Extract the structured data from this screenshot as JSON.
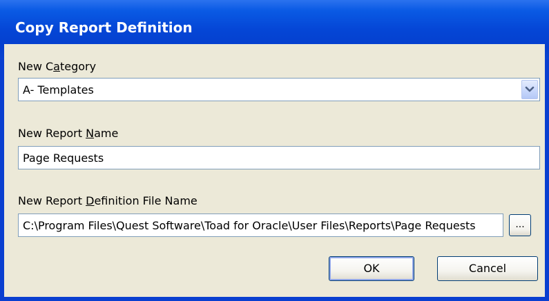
{
  "window": {
    "title": "Copy Report Definition"
  },
  "form": {
    "category": {
      "label_pre": "New C",
      "label_hot": "a",
      "label_post": "tegory",
      "value": "A- Templates"
    },
    "report_name": {
      "label_pre": "New Report ",
      "label_hot": "N",
      "label_post": "ame",
      "value": "Page Requests"
    },
    "file_name": {
      "label_pre": "New Report ",
      "label_hot": "D",
      "label_post": "efinition File Name",
      "value": "C:\\Program Files\\Quest Software\\Toad for Oracle\\User Files\\Reports\\Page Requests",
      "browse_label": "..."
    }
  },
  "buttons": {
    "ok": "OK",
    "cancel": "Cancel"
  },
  "icons": {
    "dropdown": "chevron-down-icon"
  },
  "colors": {
    "titlebar": "#0a4ad8",
    "dialog_bg": "#ece9d8",
    "input_border": "#7f9db9"
  }
}
